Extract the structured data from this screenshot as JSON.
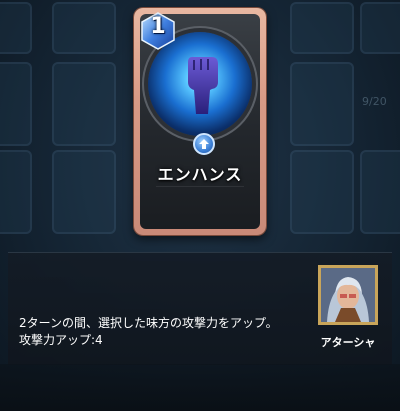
{
  "card": {
    "cost": "1",
    "name": "エンハンス",
    "boost_icon": "up-arrow-icon",
    "art_icon": "fist-icon"
  },
  "background": {
    "counter": "9/20"
  },
  "description": {
    "line1": "2ターンの間、選択した味方の攻撃力をアップ。",
    "line2": "攻撃力アップ:4"
  },
  "character": {
    "name": "アターシャ"
  },
  "colors": {
    "card_frame": "#d89a86",
    "accent_blue": "#3b7fd6",
    "portrait_frame": "#c9a55a"
  }
}
